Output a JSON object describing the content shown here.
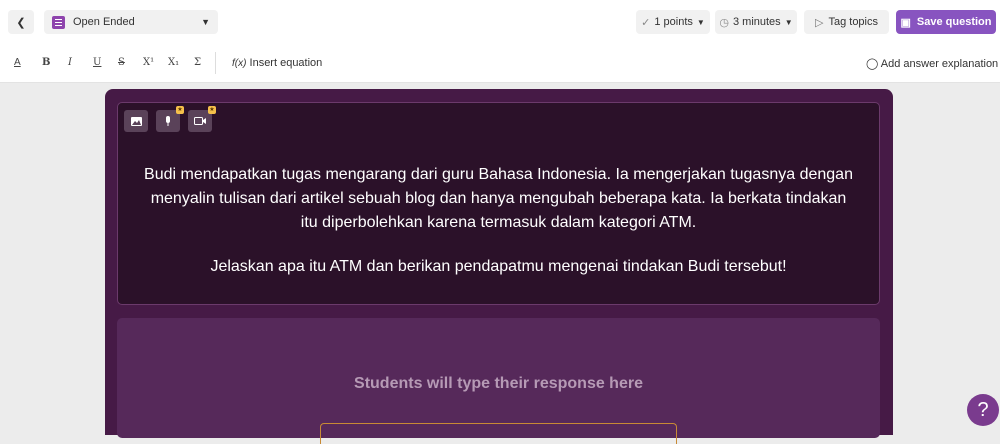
{
  "header": {
    "back_icon": "chevron-left-icon",
    "question_type": "Open Ended",
    "points": "1 points",
    "time": "3 minutes",
    "tag_topics": "Tag topics",
    "save_question": "Save question"
  },
  "toolbar": {
    "text_color": "A",
    "bold": "B",
    "italic": "I",
    "underline": "U",
    "strikethrough": "S",
    "superscript": "X¹",
    "subscript": "X₁",
    "sigma": "Σ",
    "insert_equation": "Insert equation",
    "add_explanation": "Add answer explanation"
  },
  "question": {
    "line1": "Budi mendapatkan tugas mengarang dari guru Bahasa Indonesia. Ia mengerjakan tugasnya dengan",
    "line2": "menyalin tulisan dari artikel sebuah blog dan hanya mengubah beberapa kata. Ia berkata tindakan",
    "line3": "itu diperbolehkan karena termasuk dalam kategori ATM.",
    "line4": "Jelaskan apa itu ATM dan berikan pendapatmu mengenai tindakan Budi tersebut!"
  },
  "answer": {
    "placeholder": "Students will type their response here"
  },
  "help": "?",
  "colors": {
    "accent": "#8854c0",
    "card_bg": "#461a46",
    "question_bg": "#2b1129"
  }
}
